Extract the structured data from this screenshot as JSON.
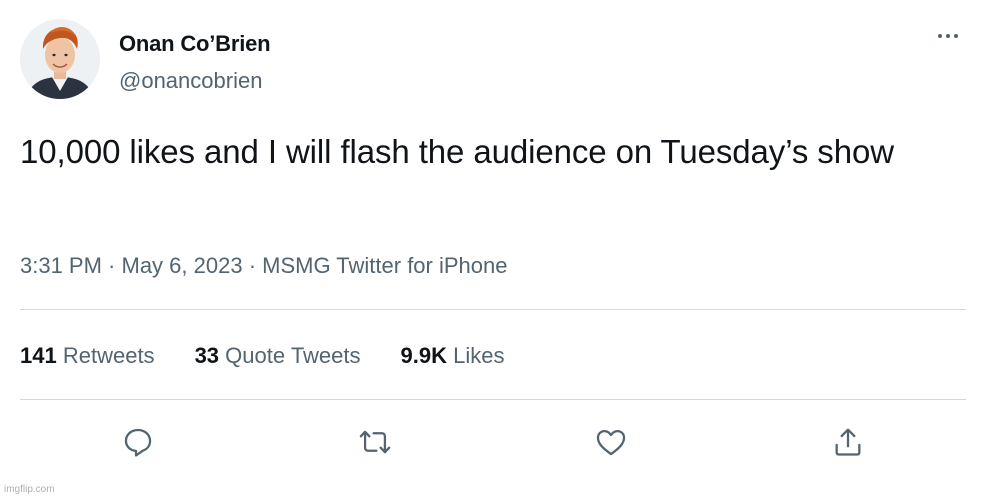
{
  "author": {
    "display_name": "Onan Co’Brien",
    "handle": "@onancobrien"
  },
  "tweet": {
    "text": "10,000 likes and I will flash the audience on Tuesday’s show"
  },
  "meta": {
    "time": "3:31 PM",
    "separator": " · ",
    "date": "May 6, 2023",
    "source": "MSMG Twitter for iPhone"
  },
  "stats": {
    "retweets_count": "141",
    "retweets_label": "Retweets",
    "quote_tweets_count": "33",
    "quote_tweets_label": "Quote Tweets",
    "likes_count": "9.9K",
    "likes_label": "Likes"
  },
  "actions": [
    "reply-icon",
    "retweet-icon",
    "like-icon",
    "share-icon"
  ],
  "watermark": "imgflip.com",
  "colors": {
    "text_primary": "#0f1419",
    "text_secondary": "#536471",
    "divider": "#cfd9de",
    "icon": "#536471",
    "background": "#ffffff"
  }
}
